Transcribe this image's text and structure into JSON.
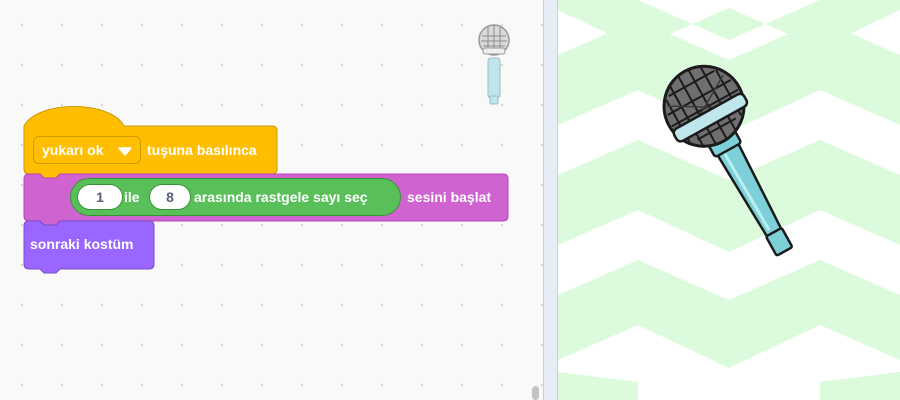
{
  "workspace": {
    "event_block": {
      "key_dropdown_value": "yukarı ok",
      "label": "tuşuna basılınca",
      "color": "#ffbf00"
    },
    "sound_block": {
      "random_block": {
        "from_value": "1",
        "mid_label": "ile",
        "to_value": "8",
        "suffix_label": "arasında rastgele sayı seç",
        "color": "#59c059"
      },
      "label": "sesini başlat",
      "color": "#cf63cf"
    },
    "looks_block": {
      "label": "sonraki kostüm",
      "color": "#9966ff"
    },
    "sprite_thumbnail_icon": "microphone-icon"
  },
  "stage": {
    "sprite_icon": "microphone-icon",
    "background_color": "#dcfadc"
  }
}
